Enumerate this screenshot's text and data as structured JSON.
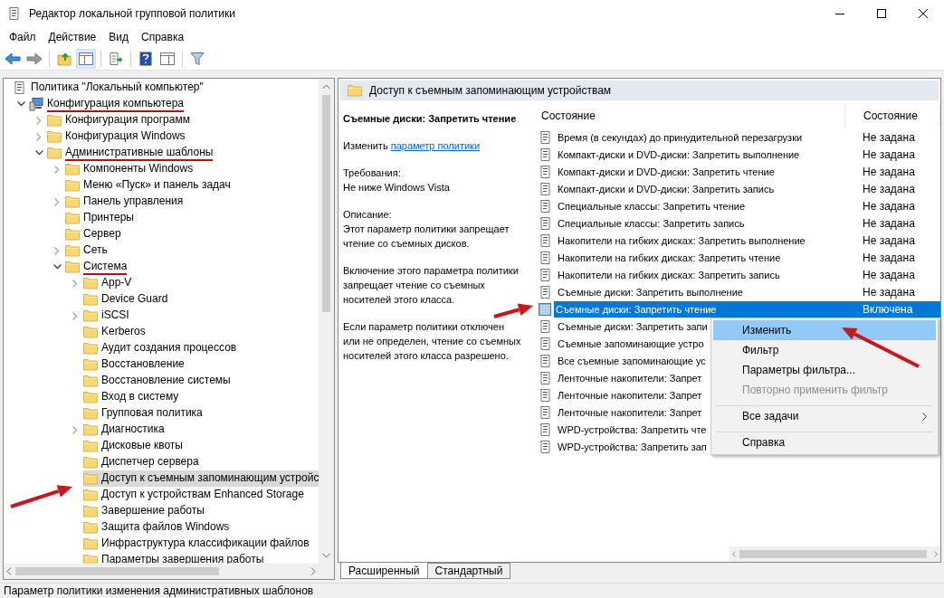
{
  "window": {
    "title": "Редактор локальной групповой политики"
  },
  "menu": [
    "Файл",
    "Действие",
    "Вид",
    "Справка"
  ],
  "tree": [
    {
      "label": "Политика \"Локальный компьютер\"",
      "kind": "root",
      "selected": false,
      "children": [
        {
          "label": "Конфигурация компьютера",
          "kind": "expanded",
          "selected": false,
          "annotated": true,
          "children": [
            {
              "label": "Конфигурация программ",
              "kind": "collapsed",
              "selected": false
            },
            {
              "label": "Конфигурация Windows",
              "kind": "collapsed",
              "selected": false
            },
            {
              "label": "Административные шаблоны",
              "kind": "expanded",
              "selected": false,
              "annotated": true,
              "children": [
                {
                  "label": "Компоненты Windows",
                  "kind": "collapsed",
                  "selected": false
                },
                {
                  "label": "Меню «Пуск» и панель задач",
                  "kind": "leaf",
                  "selected": false
                },
                {
                  "label": "Панель управления",
                  "kind": "collapsed",
                  "selected": false
                },
                {
                  "label": "Принтеры",
                  "kind": "leaf",
                  "selected": false
                },
                {
                  "label": "Сервер",
                  "kind": "leaf",
                  "selected": false
                },
                {
                  "label": "Сеть",
                  "kind": "collapsed",
                  "selected": false
                },
                {
                  "label": "Система",
                  "kind": "expanded",
                  "selected": false,
                  "annotated": true,
                  "children": [
                    {
                      "label": "App-V",
                      "kind": "collapsed",
                      "selected": false
                    },
                    {
                      "label": "Device Guard",
                      "kind": "leaf",
                      "selected": false
                    },
                    {
                      "label": "iSCSI",
                      "kind": "collapsed",
                      "selected": false
                    },
                    {
                      "label": "Kerberos",
                      "kind": "leaf",
                      "selected": false
                    },
                    {
                      "label": "Аудит создания процессов",
                      "kind": "leaf",
                      "selected": false
                    },
                    {
                      "label": "Восстановление",
                      "kind": "leaf",
                      "selected": false
                    },
                    {
                      "label": "Восстановление системы",
                      "kind": "leaf",
                      "selected": false
                    },
                    {
                      "label": "Вход в систему",
                      "kind": "leaf",
                      "selected": false
                    },
                    {
                      "label": "Групповая политика",
                      "kind": "leaf",
                      "selected": false
                    },
                    {
                      "label": "Диагностика",
                      "kind": "collapsed",
                      "selected": false
                    },
                    {
                      "label": "Дисковые квоты",
                      "kind": "leaf",
                      "selected": false
                    },
                    {
                      "label": "Диспетчер сервера",
                      "kind": "leaf",
                      "selected": false
                    },
                    {
                      "label": "Доступ к съемным запоминающим устройс",
                      "kind": "leaf",
                      "selected": true
                    },
                    {
                      "label": "Доступ к устройствам Enhanced Storage",
                      "kind": "leaf",
                      "selected": false
                    },
                    {
                      "label": "Завершение работы",
                      "kind": "leaf",
                      "selected": false
                    },
                    {
                      "label": "Защита файлов Windows",
                      "kind": "leaf",
                      "selected": false
                    },
                    {
                      "label": "Инфраструктура классификации файлов",
                      "kind": "leaf",
                      "selected": false
                    },
                    {
                      "label": "Параметры завершения работы",
                      "kind": "leaf",
                      "selected": false
                    }
                  ]
                }
              ]
            }
          ]
        }
      ]
    }
  ],
  "details": {
    "header": "Доступ к съемным запоминающим устройствам",
    "title": "Съемные диски: Запретить чтение",
    "edit_prefix": "Изменить",
    "edit_link": "параметр политики",
    "sections": [
      {
        "heading": "Требования:",
        "text": "Не ниже Windows Vista"
      },
      {
        "heading": "Описание:",
        "text": "Этот параметр политики запрещает чтение со съемных дисков."
      },
      {
        "text": "Включение этого параметра политики запрещает чтение со съемных носителей этого класса."
      },
      {
        "text": "Если параметр политики отключен или не определен, чтение со съемных носителей этого класса разрешено."
      }
    ]
  },
  "list": {
    "columns": [
      "Состояние",
      "Состояние"
    ],
    "rows": [
      {
        "name": "Время (в секундах) до принудительной перезагрузки",
        "status": "Не задана",
        "selected": false
      },
      {
        "name": "Компакт-диски и DVD-диски: Запретить выполнение",
        "status": "Не задана",
        "selected": false
      },
      {
        "name": "Компакт-диски и DVD-диски: Запретить чтение",
        "status": "Не задана",
        "selected": false
      },
      {
        "name": "Компакт-диски и DVD-диски: Запретить запись",
        "status": "Не задана",
        "selected": false
      },
      {
        "name": "Специальные классы: Запретить чтение",
        "status": "Не задана",
        "selected": false
      },
      {
        "name": "Специальные классы: Запретить запись",
        "status": "Не задана",
        "selected": false
      },
      {
        "name": "Накопители на гибких дисках: Запретить выполнение",
        "status": "Не задана",
        "selected": false
      },
      {
        "name": "Накопители на гибких дисках: Запретить чтение",
        "status": "Не задана",
        "selected": false
      },
      {
        "name": "Накопители на гибких дисках: Запретить запись",
        "status": "Не задана",
        "selected": false
      },
      {
        "name": "Съемные диски: Запретить выполнение",
        "status": "Не задана",
        "selected": false
      },
      {
        "name": "Съемные диски: Запретить чтение",
        "status": "Включена",
        "selected": true
      },
      {
        "name": "Съемные диски: Запретить запи",
        "selected": false
      },
      {
        "name": "Съемные запоминающие устро",
        "selected": false
      },
      {
        "name": "Все съемные запоминающие ус",
        "selected": false
      },
      {
        "name": "Ленточные накопители: Запрет",
        "selected": false
      },
      {
        "name": "Ленточные накопители: Запрет",
        "selected": false
      },
      {
        "name": "Ленточные накопители: Запрет",
        "selected": false
      },
      {
        "name": "WPD-устройства: Запретить чте",
        "selected": false
      },
      {
        "name": "WPD-устройства: Запретить зап",
        "selected": false
      }
    ]
  },
  "context_menu": [
    {
      "label": "Изменить",
      "selected": true,
      "disabled": false,
      "separator_before": false,
      "submenu": false
    },
    {
      "label": "Фильтр",
      "selected": false,
      "disabled": false,
      "separator_before": false,
      "submenu": false
    },
    {
      "label": "Параметры фильтра...",
      "selected": false,
      "disabled": false,
      "separator_before": false,
      "submenu": false
    },
    {
      "label": "Повторно применить фильтр",
      "selected": false,
      "disabled": true,
      "separator_before": false,
      "submenu": false
    },
    {
      "label": "Все задачи",
      "selected": false,
      "disabled": false,
      "separator_before": true,
      "submenu": true
    },
    {
      "label": "Справка",
      "selected": false,
      "disabled": false,
      "separator_before": true,
      "submenu": false
    }
  ],
  "tabs": [
    {
      "label": "Расширенный",
      "selected": true
    },
    {
      "label": "Стандартный",
      "selected": false
    }
  ],
  "status_bar": "Параметр политики изменения административных шаблонов"
}
